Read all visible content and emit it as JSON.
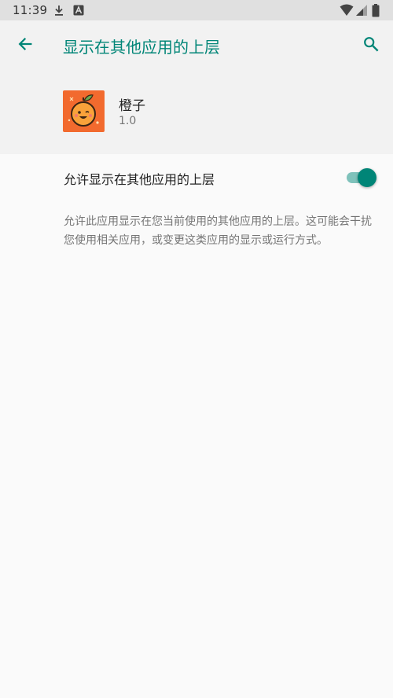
{
  "status_bar": {
    "time": "11:39",
    "icons": [
      "download-icon",
      "notification-a-icon",
      "wifi-icon",
      "cellular-signal-icon",
      "battery-icon"
    ]
  },
  "app_bar": {
    "title": "显示在其他应用的上层",
    "back_icon": "arrow-back-icon",
    "search_icon": "search-icon"
  },
  "app_info": {
    "name": "橙子",
    "version": "1.0",
    "icon": "orange-app-icon"
  },
  "setting": {
    "label": "允许显示在其他应用的上层",
    "enabled": true,
    "description": "允许此应用显示在您当前使用的其他应用的上层。这可能会干扰您使用相关应用，或变更这类应用的显示或运行方式。"
  },
  "colors": {
    "accent": "#008577",
    "switch_track": "#7fc2bb",
    "header_bg": "#f2f2f2",
    "status_bar_bg": "#e0e0e0",
    "page_bg": "#fafafa"
  }
}
